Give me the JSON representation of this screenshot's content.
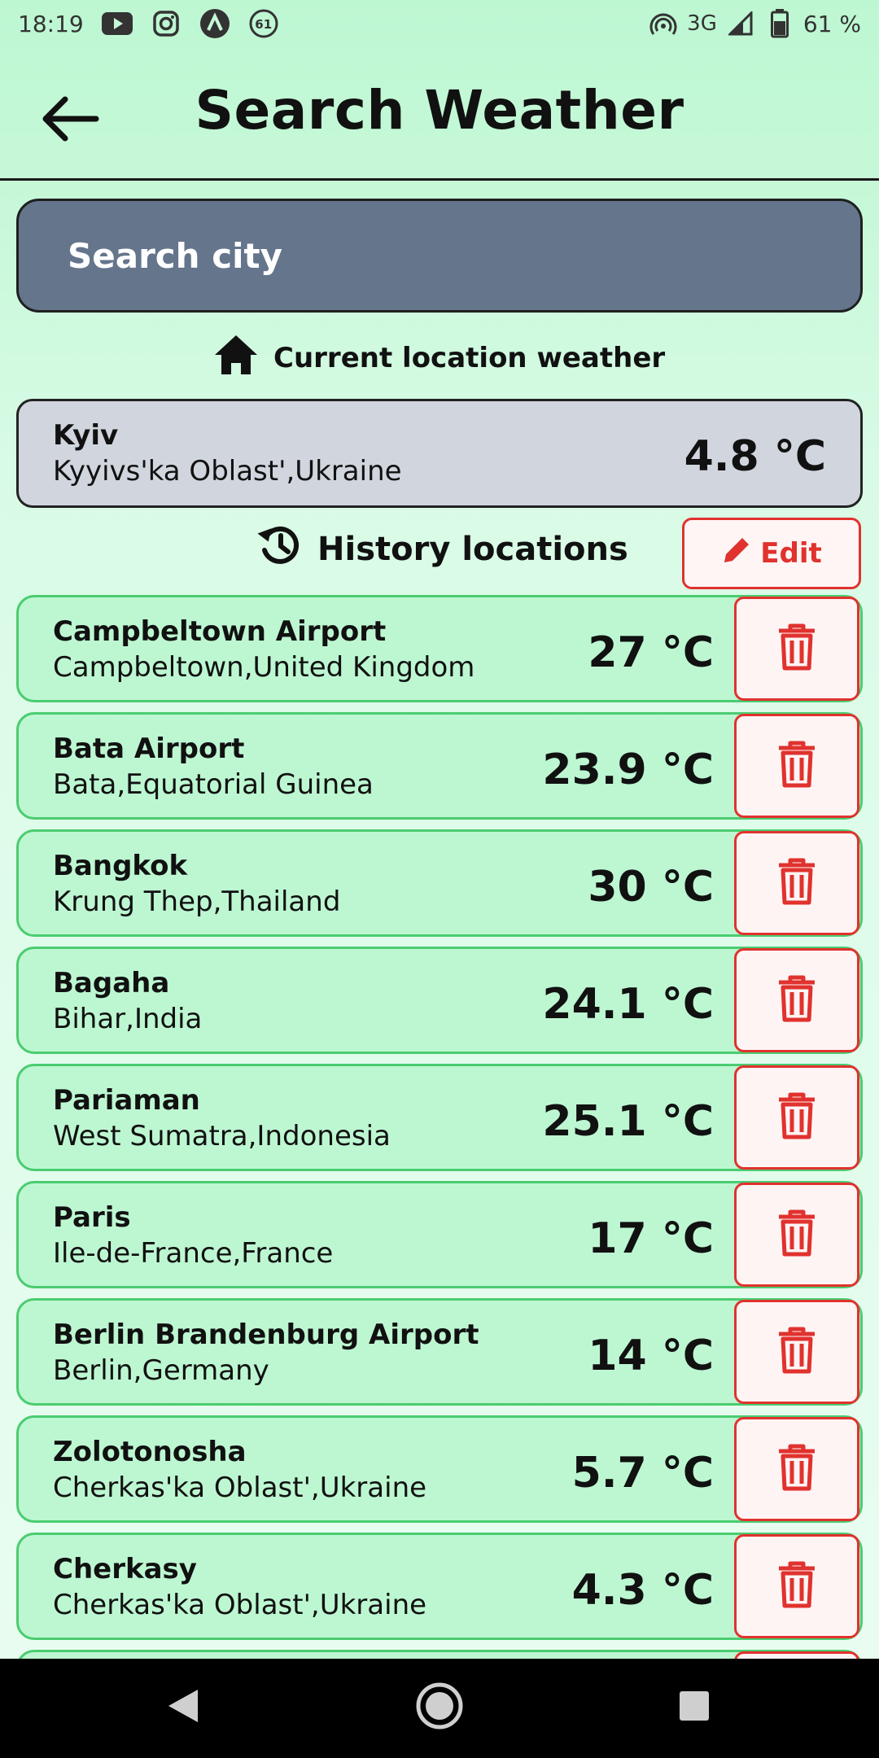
{
  "status_bar": {
    "time": "18:19",
    "notification_badge": "61",
    "network": "3G",
    "battery": "61 %",
    "icons": [
      "youtube-icon",
      "instagram-icon",
      "app-icon",
      "badge-icon",
      "hotspot-icon",
      "signal-icon",
      "battery-icon"
    ]
  },
  "app_bar": {
    "title": "Search Weather",
    "back_icon": "arrow-left-icon"
  },
  "search": {
    "placeholder": "Search city",
    "value": ""
  },
  "current_location": {
    "heading": "Current location weather",
    "icon": "home-icon",
    "name": "Kyiv",
    "region": "Kyyivs'ka Oblast',Ukraine",
    "temp": "4.8 °C"
  },
  "history": {
    "heading": "History locations",
    "icon": "history-icon",
    "edit_label": "Edit",
    "edit_icon": "pencil-icon",
    "delete_icon": "trash-icon",
    "items": [
      {
        "name": "Campbeltown Airport",
        "region": "Campbeltown,United Kingdom",
        "temp": "27 °C"
      },
      {
        "name": "Bata Airport",
        "region": "Bata,Equatorial Guinea",
        "temp": "23.9 °C"
      },
      {
        "name": "Bangkok",
        "region": "Krung Thep,Thailand",
        "temp": "30 °C"
      },
      {
        "name": "Bagaha",
        "region": "Bihar,India",
        "temp": "24.1 °C"
      },
      {
        "name": "Pariaman",
        "region": "West Sumatra,Indonesia",
        "temp": "25.1 °C"
      },
      {
        "name": "Paris",
        "region": "Ile-de-France,France",
        "temp": "17 °C"
      },
      {
        "name": "Berlin Brandenburg Airport",
        "region": "Berlin,Germany",
        "temp": "14 °C"
      },
      {
        "name": "Zolotonosha",
        "region": "Cherkas'ka Oblast',Ukraine",
        "temp": "5.7 °C"
      },
      {
        "name": "Cherkasy",
        "region": "Cherkas'ka Oblast',Ukraine",
        "temp": "4.3 °C"
      },
      {
        "name": "",
        "region": "",
        "temp": ""
      }
    ]
  },
  "colors": {
    "background": "#c6f8d8",
    "search_bg": "#64758c",
    "history_card_bg": "#bdf7d2",
    "history_card_border": "#4bcc70",
    "current_card_bg": "#d1d5de",
    "delete_red": "#e0322e"
  }
}
